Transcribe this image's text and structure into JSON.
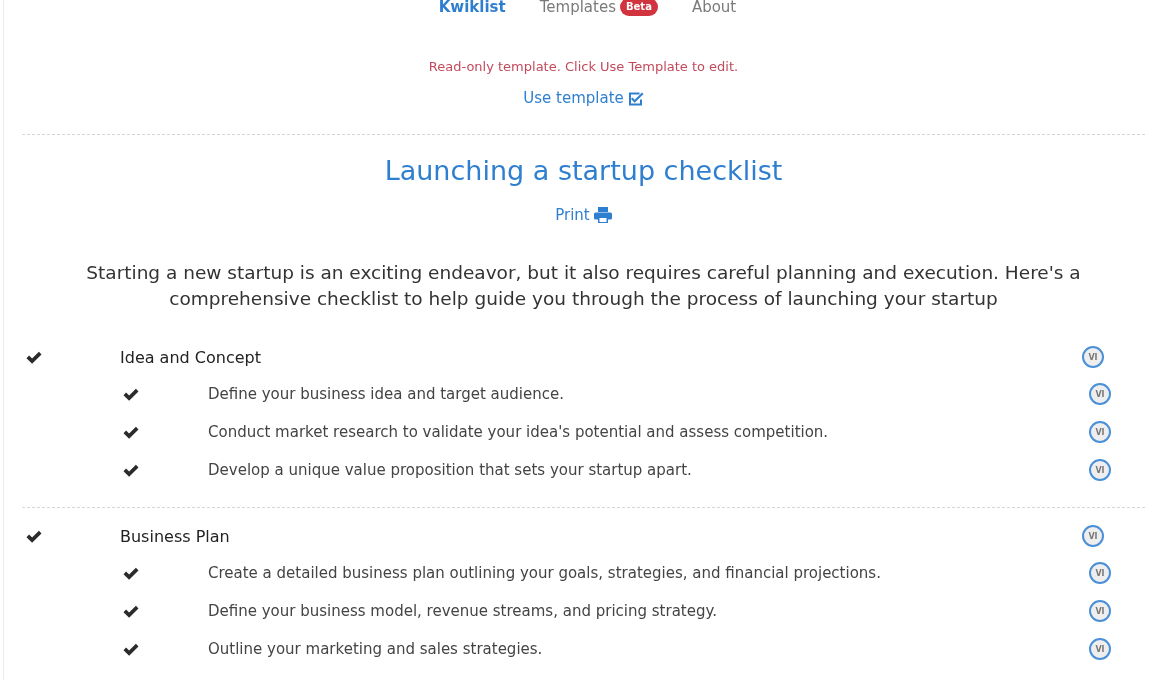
{
  "nav": [
    {
      "label": "Kwiklist",
      "selected": true
    },
    {
      "label": "Templates",
      "selected": false,
      "badge": "Beta"
    },
    {
      "label": "About",
      "selected": false
    }
  ],
  "notice": "Read-only template. Click Use Template to edit.",
  "use_template_link": "Use template",
  "title": "Launching a startup checklist",
  "print_link": "Print",
  "description": "Starting a new startup is an exciting endeavor, but it also requires careful planning and execution. Here's a comprehensive checklist to help guide you through the process of launching your startup",
  "sections": [
    {
      "title": "Idea and Concept",
      "checked": true,
      "avatar": "VI",
      "children": [
        {
          "text": "Define your business idea and target audience.",
          "checked": true,
          "avatar": "VI"
        },
        {
          "text": "Conduct market research to validate your idea's potential and assess competition.",
          "checked": true,
          "avatar": "VI"
        },
        {
          "text": "Develop a unique value proposition that sets your startup apart.",
          "checked": true,
          "avatar": "VI"
        }
      ]
    },
    {
      "title": "Business Plan",
      "checked": true,
      "avatar": "VI",
      "children": [
        {
          "text": "Create a detailed business plan outlining your goals, strategies, and financial projections.",
          "checked": true,
          "avatar": "VI"
        },
        {
          "text": "Define your business model, revenue streams, and pricing strategy.",
          "checked": true,
          "avatar": "VI"
        },
        {
          "text": "Outline your marketing and sales strategies.",
          "checked": true,
          "avatar": "VI"
        }
      ]
    }
  ]
}
